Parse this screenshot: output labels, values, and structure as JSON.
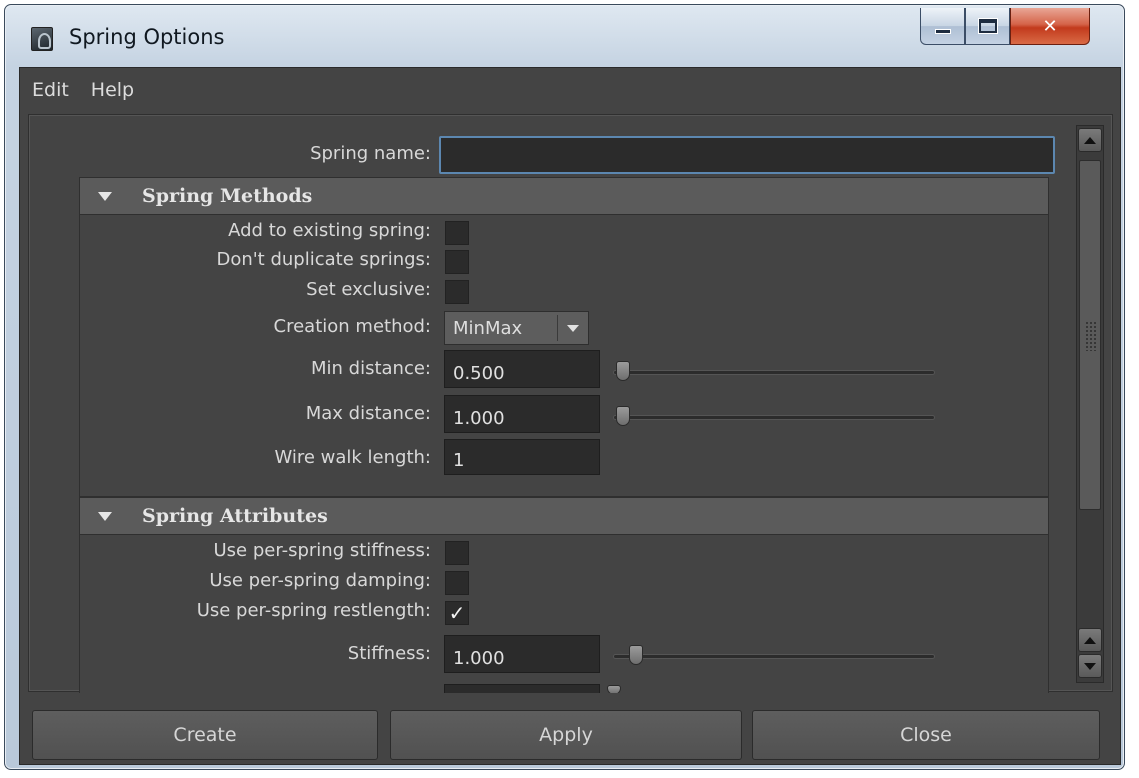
{
  "window": {
    "title": "Spring Options"
  },
  "menu": [
    "Edit",
    "Help"
  ],
  "spring_name": {
    "label": "Spring name:",
    "value": ""
  },
  "sections": {
    "methods": {
      "title": "Spring Methods",
      "add_existing": {
        "label": "Add to existing spring:",
        "checked": false
      },
      "no_duplicate": {
        "label": "Don't duplicate springs:",
        "checked": false
      },
      "set_exclusive": {
        "label": "Set exclusive:",
        "checked": false
      },
      "creation_method": {
        "label": "Creation method:",
        "value": "MinMax"
      },
      "min_distance": {
        "label": "Min distance:",
        "value": "0.500"
      },
      "max_distance": {
        "label": "Max distance:",
        "value": "1.000"
      },
      "wire_walk": {
        "label": "Wire walk length:",
        "value": "1"
      }
    },
    "attributes": {
      "title": "Spring Attributes",
      "per_stiffness": {
        "label": "Use per-spring stiffness:",
        "checked": false
      },
      "per_damping": {
        "label": "Use per-spring damping:",
        "checked": false
      },
      "per_restlength": {
        "label": "Use per-spring restlength:",
        "checked": true,
        "mark": "✓"
      },
      "stiffness": {
        "label": "Stiffness:",
        "value": "1.000"
      }
    }
  },
  "buttons": {
    "create": "Create",
    "apply": "Apply",
    "close": "Close"
  }
}
